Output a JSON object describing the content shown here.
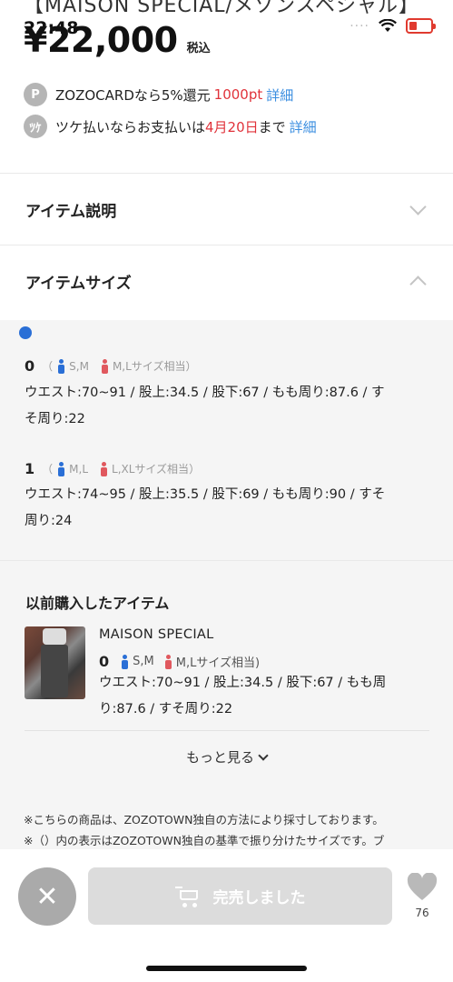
{
  "status_bar": {
    "time": "22:48",
    "cut_title": "【MAISON SPECIAL/メゾンスペシャル】",
    "signal": "····"
  },
  "product": {
    "price": "¥22,000",
    "tax_label": "税込"
  },
  "promotions": [
    {
      "badge": "P",
      "text_before": "ZOZOCARDなら5%還元",
      "highlight": "1000pt",
      "text_after": "",
      "link": "詳細"
    },
    {
      "badge": "ﾂｹ",
      "text_before": "ツケ払いならお支払いは",
      "highlight": "4月20日",
      "text_after": "まで",
      "link": "詳細"
    }
  ],
  "accordions": {
    "description": "アイテム説明",
    "size": "アイテムサイズ"
  },
  "sizes": [
    {
      "number": "0",
      "paren_open": "（",
      "male": "S,M",
      "female": "M,Lサイズ相当",
      "paren_close": "）",
      "line1": "ウエスト:70~91 / 股上:34.5 / 股下:67 / もも周り:87.6 / す",
      "line2": "そ周り:22"
    },
    {
      "number": "1",
      "paren_open": "（",
      "male": "M,L",
      "female": "L,XLサイズ相当",
      "paren_close": "）",
      "line1": "ウエスト:74~95 / 股上:35.5 / 股下:69 / もも周り:90 / すそ",
      "line2": "周り:24"
    }
  ],
  "previous_purchase": {
    "title": "以前購入したアイテム",
    "brand": "MAISON SPECIAL",
    "size_number": "0",
    "male": "S,M",
    "female": "M,Lサイズ相当)",
    "line1": "ウエスト:70~91 / 股上:34.5 / 股下:67 / もも周",
    "line2": "り:87.6 / すそ周り:22",
    "more": "もっと見る"
  },
  "notes": [
    "※こちらの商品は、ZOZOTOWN独自の方法により採寸しております。",
    "※（）内の表示はZOZOTOWN独自の基準で振り分けたサイズです。ブ"
  ],
  "bottom_bar": {
    "close_symbol": "✕",
    "soldout_label": "完売しました",
    "like_count": "76"
  },
  "colors": {
    "accent_red": "#e0323a",
    "link_blue": "#3b8ee0",
    "male_blue": "#2a6fd6",
    "female_red": "#e0585e"
  }
}
